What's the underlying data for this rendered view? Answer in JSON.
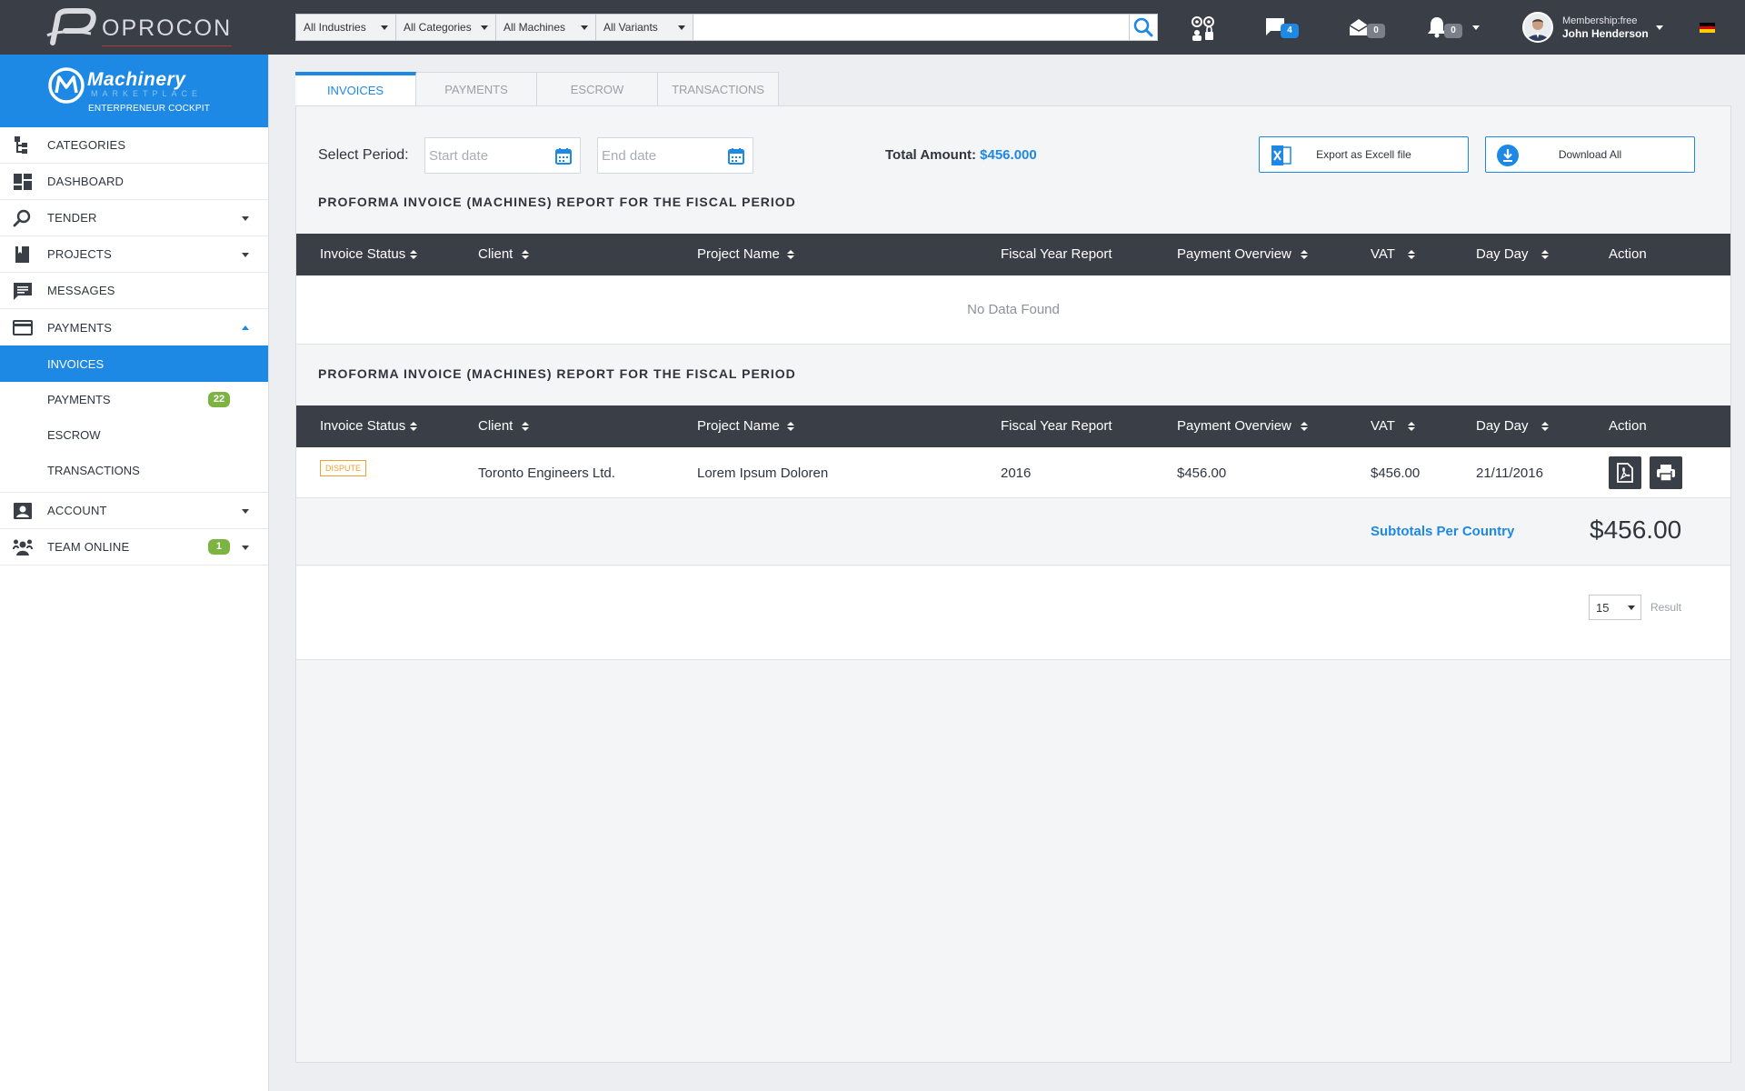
{
  "topbar": {
    "logo_text": "OPROCON",
    "filters": [
      "All Industries",
      "All Categories",
      "All Machines",
      "All Variants"
    ],
    "search_placeholder": "",
    "chat_count": "4",
    "mail_count": "0",
    "notif_count": "0",
    "membership": "Membership:free",
    "user_name": "John Henderson",
    "accent": "#1e88e5",
    "bar_color": "#3a3e47"
  },
  "sidebar": {
    "brand_title": "Machinery",
    "brand_sub": "MARKETPLACE",
    "brand_cockpit": "ENTERPRENEUR COCKPIT",
    "items": [
      {
        "label": "CATEGORIES",
        "icon": "categories-icon"
      },
      {
        "label": "DASHBOARD",
        "icon": "dashboard-icon"
      },
      {
        "label": "TENDER",
        "icon": "search-icon"
      },
      {
        "label": "PROJECTS",
        "icon": "book-icon"
      },
      {
        "label": "MESSAGES",
        "icon": "message-icon"
      },
      {
        "label": "PAYMENTS",
        "icon": "credit-card-icon"
      }
    ],
    "payments_sub": [
      {
        "label": "INVOICES"
      },
      {
        "label": "PAYMENTS",
        "badge": "22"
      },
      {
        "label": "ESCROW"
      },
      {
        "label": "TRANSACTIONS"
      }
    ],
    "account": "ACCOUNT",
    "team_online": "TEAM ONLINE",
    "team_online_badge": "1"
  },
  "tabs": [
    "INVOICES",
    "PAYMENTS",
    "ESCROW",
    "TRANSACTIONS"
  ],
  "toolbar": {
    "select_period": "Select Period:",
    "start_placeholder": "Start date",
    "end_placeholder": "End date",
    "total_label": "Total Amount:",
    "total_value": "$456.000",
    "export_label": "Export as Excell file",
    "download_label": "Download All"
  },
  "report_title": "PROFORMA INVOICE (MACHINES) REPORT FOR THE FISCAL PERIOD",
  "columns": [
    "Invoice Status",
    "Client",
    "Project Name",
    "Fiscal Year Report",
    "Payment Overview",
    "VAT",
    "Day Day",
    "Action"
  ],
  "table1": {
    "empty_text": "No Data Found"
  },
  "table2": {
    "rows": [
      {
        "status": "DISPUTE",
        "client": "Toronto Engineers Ltd.",
        "project": "Lorem Ipsum Doloren",
        "fiscal_year": "2016",
        "payment": "$456.00",
        "vat": "$456.00",
        "date": "21/11/2016"
      }
    ],
    "subtotal_label": "Subtotals Per Country",
    "subtotal_value": "$456.00"
  },
  "pager": {
    "page_size": "15",
    "result_label": "Result"
  }
}
